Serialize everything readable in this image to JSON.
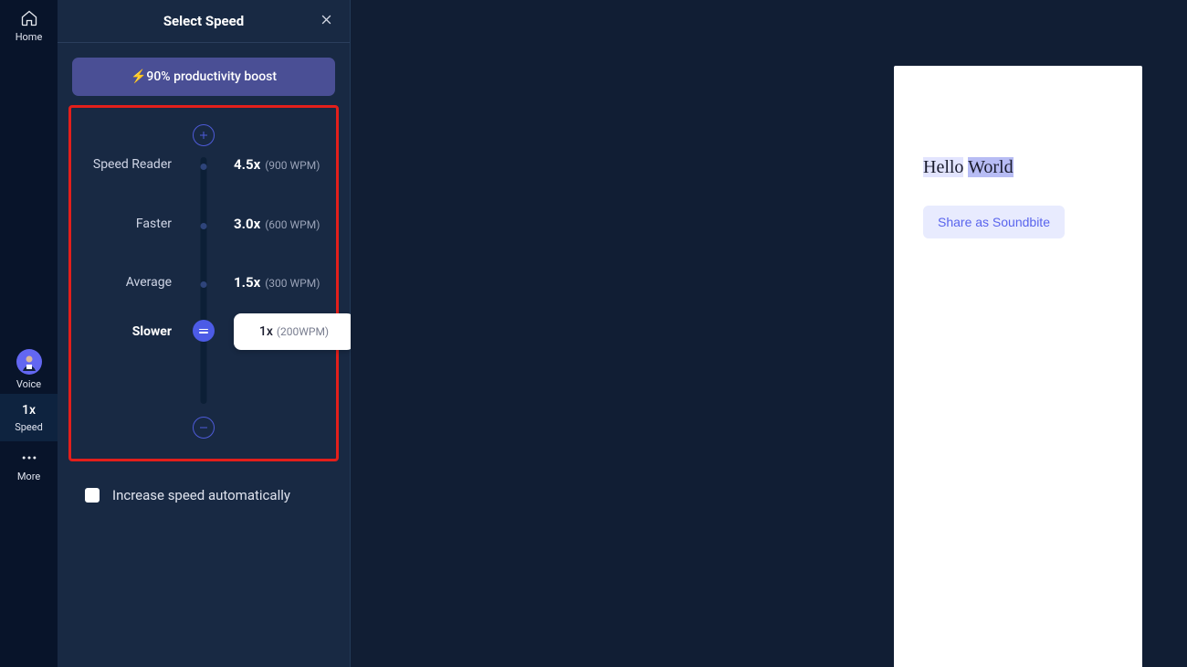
{
  "sidebar": {
    "home_label": "Home",
    "voice_label": "Voice",
    "speed_mult": "1x",
    "speed_label": "Speed",
    "more_label": "More"
  },
  "panel": {
    "title": "Select Speed",
    "boost_text": "⚡90% productivity boost",
    "rows": [
      {
        "label": "Speed Reader",
        "mult": "4.5x",
        "wpm": "(900 WPM)"
      },
      {
        "label": "Faster",
        "mult": "3.0x",
        "wpm": "(600 WPM)"
      },
      {
        "label": "Average",
        "mult": "1.5x",
        "wpm": "(300 WPM)"
      },
      {
        "label": "Slower",
        "mult": "1x",
        "wpm": "(200WPM)"
      }
    ],
    "auto_label": "Increase speed automatically"
  },
  "doc": {
    "word1": "Hello",
    "space": " ",
    "word2": "World",
    "share_label": "Share as Soundbite"
  }
}
